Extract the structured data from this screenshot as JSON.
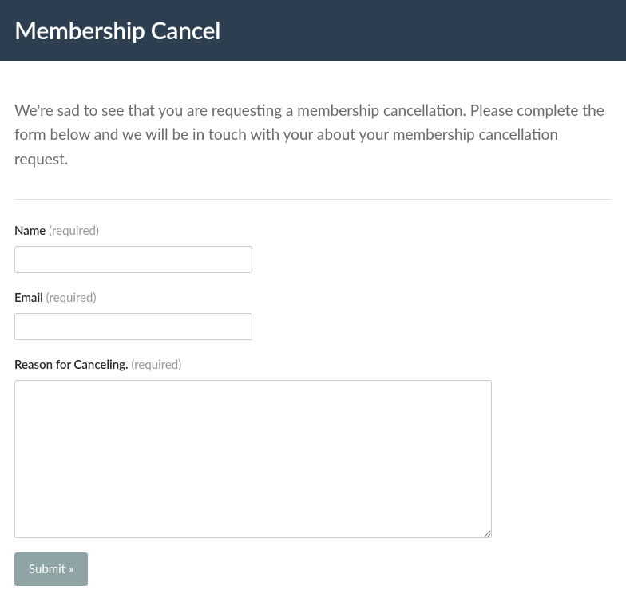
{
  "header": {
    "title": "Membership Cancel"
  },
  "intro": "We're sad to see that you are requesting a membership cancellation. Please complete the form below and we will be in touch with your about your membership cancellation request.",
  "form": {
    "name": {
      "label": "Name",
      "required_text": "(required)",
      "value": ""
    },
    "email": {
      "label": "Email",
      "required_text": "(required)",
      "value": ""
    },
    "reason": {
      "label": "Reason for Canceling.",
      "required_text": "(required)",
      "value": ""
    },
    "submit_label": "Submit »"
  }
}
